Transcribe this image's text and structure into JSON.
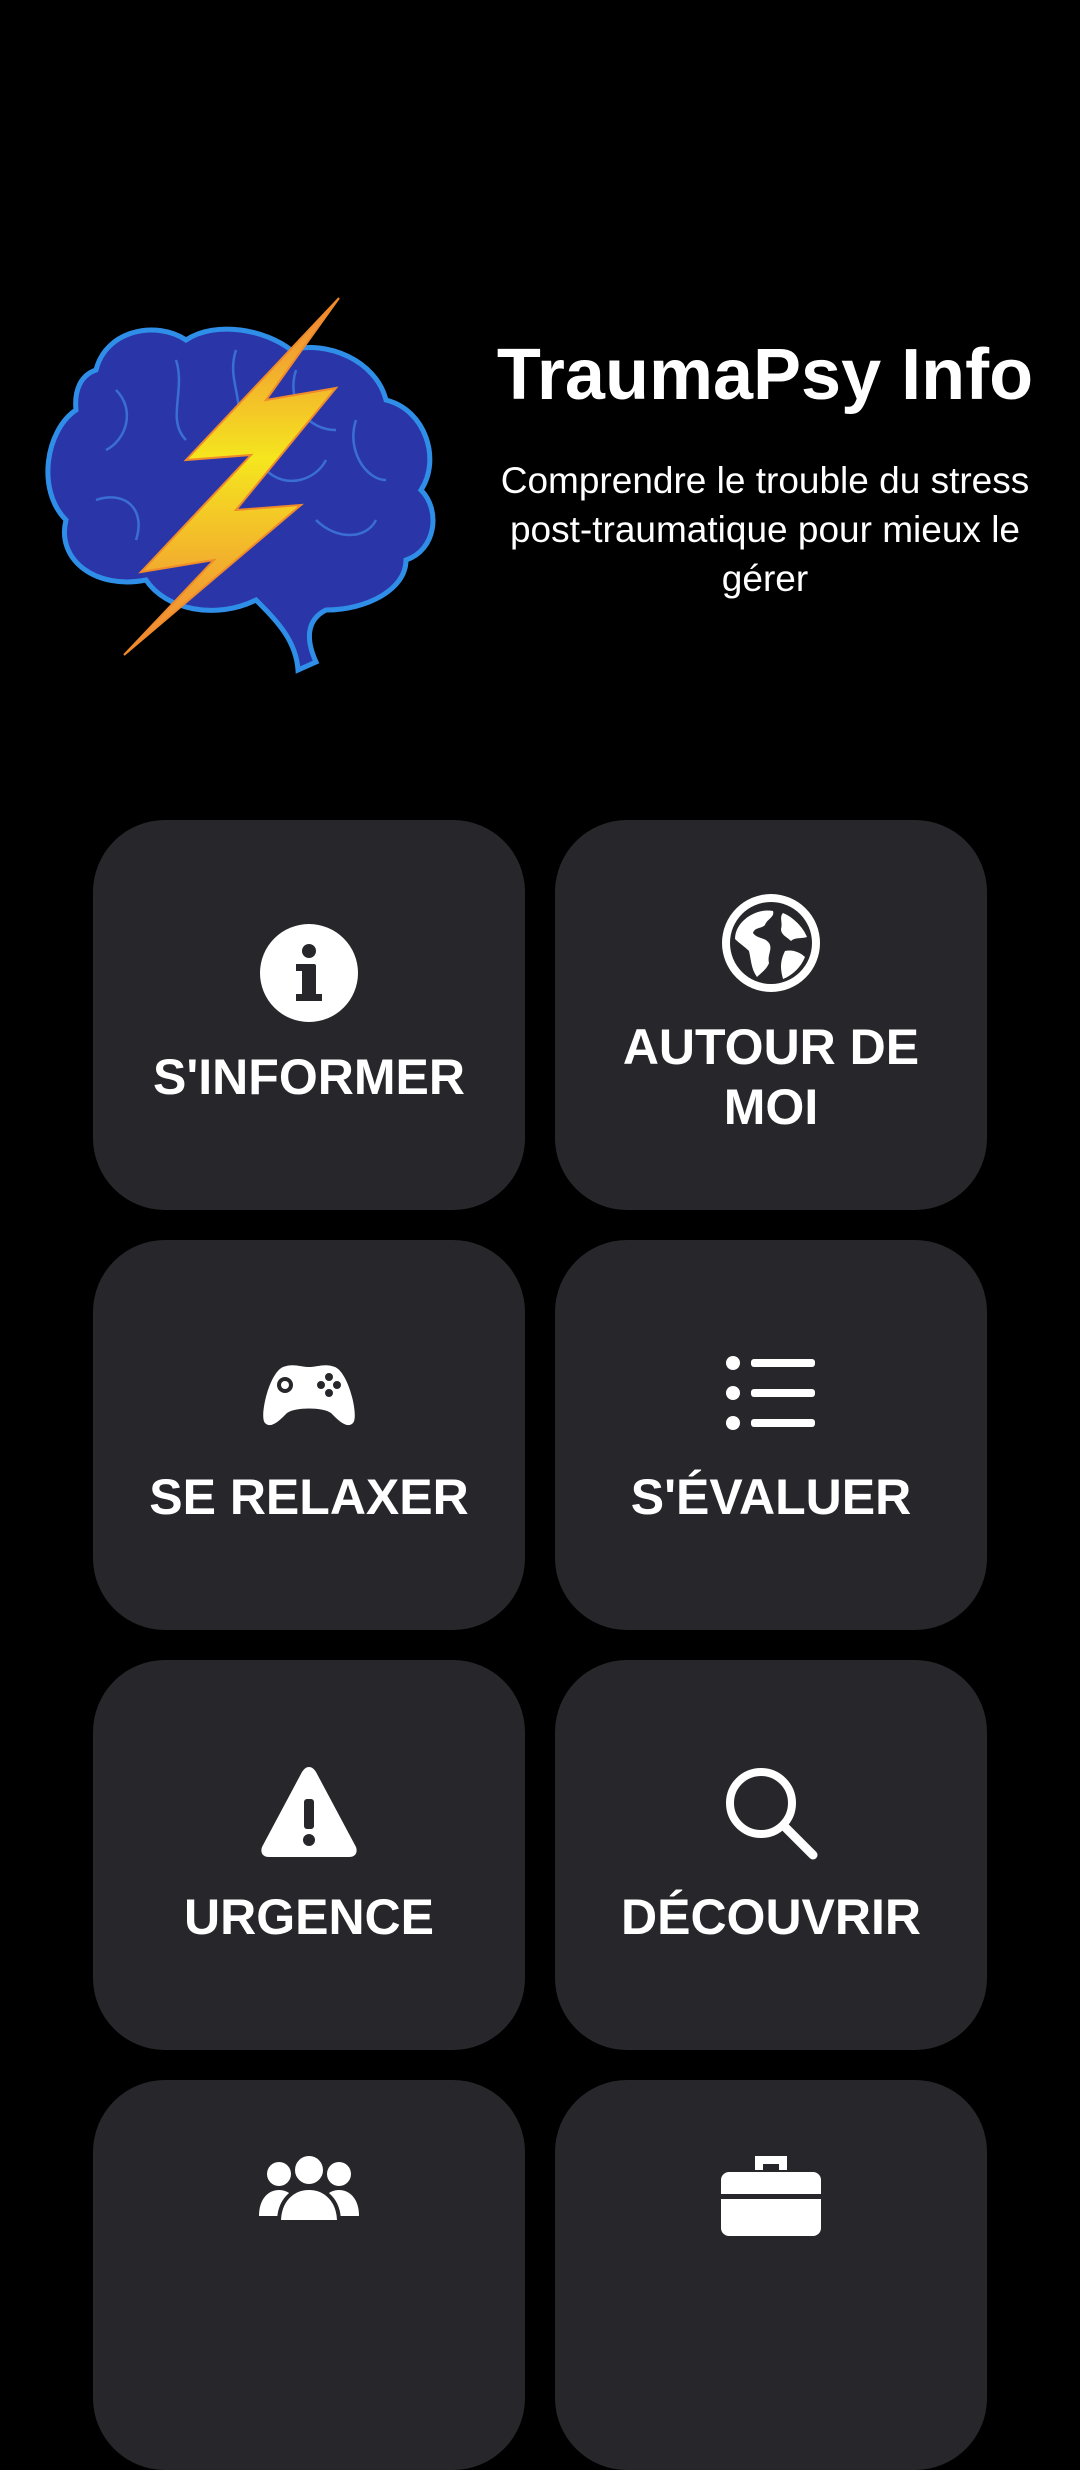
{
  "header": {
    "title": "TraumaPsy Info",
    "subtitle": "Comprendre le trouble du stress post-traumatique pour mieux le gérer",
    "logo_icon": "brain-lightning-logo"
  },
  "menu": {
    "items": [
      {
        "label": "S'INFORMER",
        "icon": "info-icon"
      },
      {
        "label": "AUTOUR DE MOI",
        "icon": "globe-icon"
      },
      {
        "label": "SE RELAXER",
        "icon": "gamepad-icon"
      },
      {
        "label": "S'ÉVALUER",
        "icon": "list-icon"
      },
      {
        "label": "URGENCE",
        "icon": "warning-icon"
      },
      {
        "label": "DÉCOUVRIR",
        "icon": "search-icon"
      },
      {
        "label": "",
        "icon": "group-icon"
      },
      {
        "label": "",
        "icon": "toolbox-icon"
      }
    ]
  },
  "colors": {
    "background": "#000000",
    "tile": "#27272b",
    "text": "#ffffff",
    "brain": "#2a36a8",
    "brain_outline": "#2f8fe8",
    "bolt_top": "#f5e61e",
    "bolt_bottom": "#f0813a"
  }
}
